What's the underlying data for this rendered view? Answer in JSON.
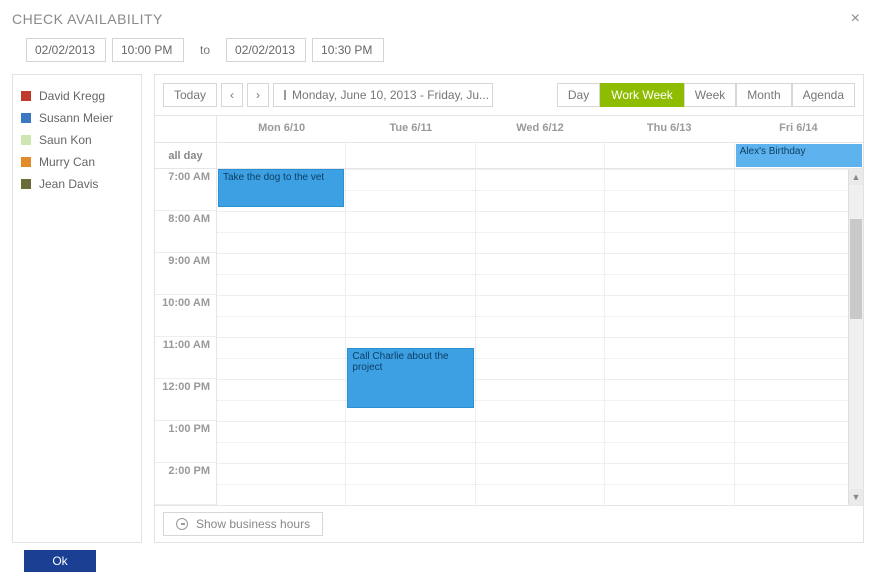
{
  "title": "CHECK AVAILABILITY",
  "close": "×",
  "range": {
    "fromDate": "02/02/2013",
    "fromTime": "10:00 PM",
    "to": "to",
    "toDate": "02/02/2013",
    "toTime": "10:30 PM"
  },
  "people": [
    {
      "name": "David Kregg",
      "color": "#c0392b"
    },
    {
      "name": "Susann Meier",
      "color": "#3b78c3"
    },
    {
      "name": "Saun Kon",
      "color": "#cde6b2"
    },
    {
      "name": "Murry Can",
      "color": "#e38b2b"
    },
    {
      "name": "Jean Davis",
      "color": "#6b6b3a"
    }
  ],
  "toolbar": {
    "today": "Today",
    "prev": "‹",
    "next": "›",
    "rangeText": "Monday, June 10, 2013 - Friday, Ju..."
  },
  "views": {
    "day": "Day",
    "workweek": "Work Week",
    "week": "Week",
    "month": "Month",
    "agenda": "Agenda",
    "active": "workweek"
  },
  "days": [
    {
      "label": "Mon 6/10"
    },
    {
      "label": "Tue 6/11"
    },
    {
      "label": "Wed 6/12"
    },
    {
      "label": "Thu 6/13"
    },
    {
      "label": "Fri 6/14"
    }
  ],
  "allday_label": "all day",
  "allday_events": [
    {
      "day": 4,
      "title": "Alex's Birthday"
    }
  ],
  "hours": [
    "7:00 AM",
    "8:00 AM",
    "9:00 AM",
    "10:00 AM",
    "11:00 AM",
    "12:00 PM",
    "1:00 PM",
    "2:00 PM"
  ],
  "events": [
    {
      "day": 0,
      "startSlot": 0,
      "height": 38,
      "title": "Take the dog to the vet"
    },
    {
      "day": 1,
      "startSlot": 4.25,
      "height": 60,
      "title": "Call Charlie about the project"
    }
  ],
  "footer": {
    "businessHours": "Show business hours"
  },
  "ok": "Ok"
}
